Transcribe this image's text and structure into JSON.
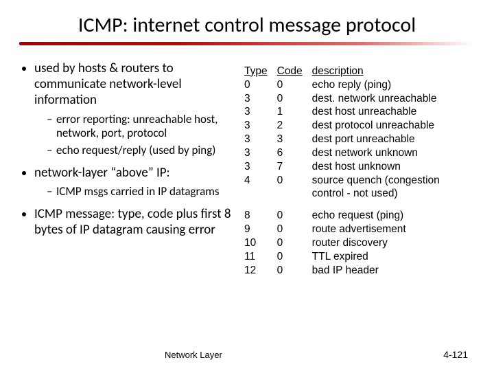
{
  "title": "ICMP: internet control message protocol",
  "left": {
    "b1": "used by hosts & routers to communicate network-level information",
    "b1s1": "error reporting: unreachable host, network, port, protocol",
    "b1s2": "echo request/reply (used by ping)",
    "b2pre": "network-layer ",
    "b2q": "“above”",
    "b2post": " IP:",
    "b2s1": "ICMP msgs carried in IP datagrams",
    "b3_a": "ICMP message:",
    "b3_b": " type, code plus first 8 bytes of IP datagram causing error"
  },
  "table": {
    "h_type": "Type",
    "h_code": "Code",
    "h_desc": "description",
    "rows": [
      {
        "t": "0",
        "c": "0",
        "d": "echo reply (ping)"
      },
      {
        "t": "3",
        "c": "0",
        "d": "dest. network unreachable"
      },
      {
        "t": "3",
        "c": "1",
        "d": "dest host unreachable"
      },
      {
        "t": "3",
        "c": "2",
        "d": "dest protocol unreachable"
      },
      {
        "t": "3",
        "c": "3",
        "d": "dest port unreachable"
      },
      {
        "t": "3",
        "c": "6",
        "d": "dest network unknown"
      },
      {
        "t": "3",
        "c": "7",
        "d": "dest host unknown"
      },
      {
        "t": "4",
        "c": "0",
        "d": "source quench (congestion control - not used)"
      },
      {
        "t": "8",
        "c": "0",
        "d": "echo request (ping)"
      },
      {
        "t": "9",
        "c": "0",
        "d": "route advertisement"
      },
      {
        "t": "10",
        "c": "0",
        "d": "router discovery"
      },
      {
        "t": "11",
        "c": "0",
        "d": "TTL expired"
      },
      {
        "t": "12",
        "c": "0",
        "d": "bad IP header"
      }
    ]
  },
  "footer": {
    "left": "Network Layer",
    "right": "4-121"
  }
}
